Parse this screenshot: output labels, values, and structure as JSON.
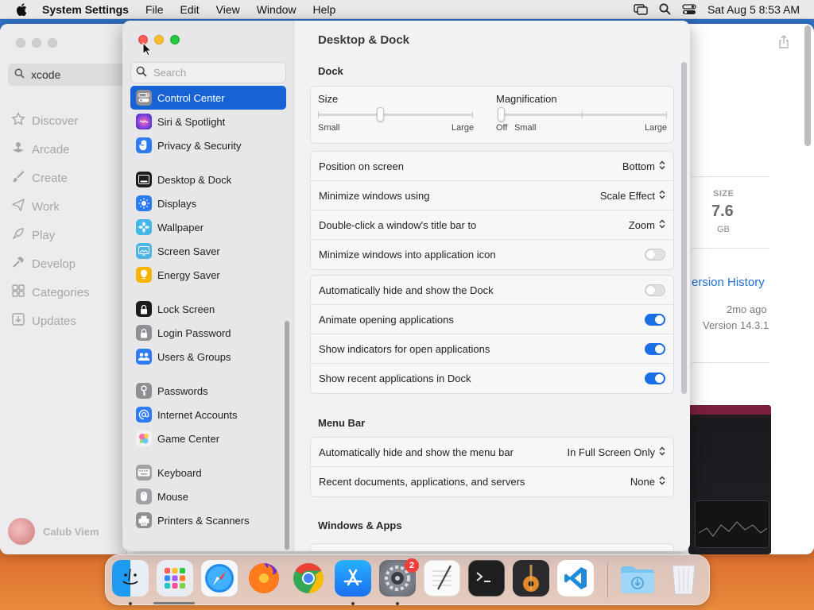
{
  "menubar": {
    "app_name": "System Settings",
    "menus": [
      "File",
      "Edit",
      "View",
      "Window",
      "Help"
    ],
    "clock": "Sat Aug 5  8:53 AM"
  },
  "appstore": {
    "search_value": "xcode",
    "nav": [
      "Discover",
      "Arcade",
      "Create",
      "Work",
      "Play",
      "Develop",
      "Categories",
      "Updates"
    ],
    "user_name": "Calub Viem",
    "size_label": "SIZE",
    "size_value": "7.6",
    "size_unit": "GB",
    "version_history": "ersion History",
    "time_ago": "2mo ago",
    "version": "Version 14.3.1"
  },
  "settings": {
    "search_placeholder": "Search",
    "sidebar": [
      {
        "label": "Control Center",
        "icon": "control-center-icon",
        "color": "#8e8e93",
        "selected": true
      },
      {
        "label": "Siri & Spotlight",
        "icon": "siri-icon",
        "color": "#a64fd8"
      },
      {
        "label": "Privacy & Security",
        "icon": "hand-icon",
        "color": "#2d7cf6"
      },
      {
        "label": "Desktop & Dock",
        "icon": "dock-icon",
        "color": "#1c1c1e"
      },
      {
        "label": "Displays",
        "icon": "sun-icon",
        "color": "#2a7af0"
      },
      {
        "label": "Wallpaper",
        "icon": "flower-icon",
        "color": "#45b6e8"
      },
      {
        "label": "Screen Saver",
        "icon": "screen-saver-icon",
        "color": "#4fb3e3"
      },
      {
        "label": "Energy Saver",
        "icon": "bulb-icon",
        "color": "#f7b500"
      },
      {
        "label": "Lock Screen",
        "icon": "lock-icon",
        "color": "#1c1c1e"
      },
      {
        "label": "Login Password",
        "icon": "lock-icon",
        "color": "#8e8e93"
      },
      {
        "label": "Users & Groups",
        "icon": "users-icon",
        "color": "#2d7cf6"
      },
      {
        "label": "Passwords",
        "icon": "key-icon",
        "color": "#8e8e93"
      },
      {
        "label": "Internet Accounts",
        "icon": "at-icon",
        "color": "#2d7cf6"
      },
      {
        "label": "Game Center",
        "icon": "game-center-icon",
        "color": "#e8e8ea"
      },
      {
        "label": "Keyboard",
        "icon": "keyboard-icon",
        "color": "#a2a2a6"
      },
      {
        "label": "Mouse",
        "icon": "mouse-icon",
        "color": "#a2a2a6"
      },
      {
        "label": "Printers & Scanners",
        "icon": "printer-icon",
        "color": "#8e8e93"
      }
    ],
    "page_title": "Desktop & Dock",
    "dock_section": "Dock",
    "size_title": "Size",
    "size_small": "Small",
    "size_large": "Large",
    "mag_title": "Magnification",
    "mag_off": "Off",
    "mag_small": "Small",
    "mag_large": "Large",
    "size_level": 0.4,
    "mag_level": 0.0,
    "popups": [
      {
        "label": "Position on screen",
        "value": "Bottom"
      },
      {
        "label": "Minimize windows using",
        "value": "Scale Effect"
      },
      {
        "label": "Double-click a window's title bar to",
        "value": "Zoom"
      }
    ],
    "minimize_into_icon": {
      "label": "Minimize windows into application icon",
      "on": false
    },
    "toggles": [
      {
        "label": "Automatically hide and show the Dock",
        "on": false
      },
      {
        "label": "Animate opening applications",
        "on": true
      },
      {
        "label": "Show indicators for open applications",
        "on": true
      },
      {
        "label": "Show recent applications in Dock",
        "on": true
      }
    ],
    "menubar_section": "Menu Bar",
    "menubar_popups": [
      {
        "label": "Automatically hide and show the menu bar",
        "value": "In Full Screen Only"
      },
      {
        "label": "Recent documents, applications, and servers",
        "value": "None"
      }
    ],
    "windows_section": "Windows & Apps"
  },
  "dock": {
    "apps": [
      "finder",
      "launchpad",
      "safari",
      "firefox",
      "chrome",
      "app-store",
      "system-settings",
      "textedit",
      "terminal",
      "garageband",
      "vscode",
      "downloads",
      "trash"
    ],
    "settings_badge": "2"
  }
}
